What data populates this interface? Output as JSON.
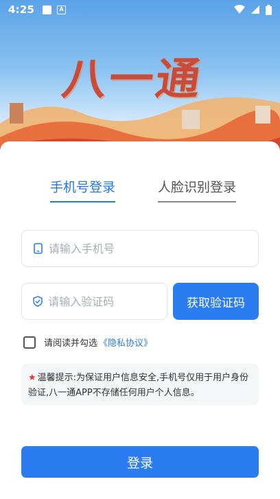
{
  "status_bar": {
    "time": "4:25",
    "icons": [
      "square-icon",
      "a-icon",
      "wifi-icon",
      "signal-icon",
      "battery-icon"
    ]
  },
  "banner": {
    "calligraphy": "八一通"
  },
  "tabs": {
    "phone_login": "手机号登录",
    "face_login": "人脸识别登录",
    "active": "phone_login"
  },
  "form": {
    "phone_placeholder": "请输入手机号",
    "code_placeholder": "请输入验证码",
    "get_code_label": "获取验证码"
  },
  "agreement": {
    "text": "请阅读并勾选",
    "link": "《隐私协议》",
    "checked": false
  },
  "notice": {
    "star": "★",
    "text": "温馨提示:为保证用户信息安全,手机号仅用于用户身份验证,八一通APP不存储任何用户个人信息。"
  },
  "login_button": "登录",
  "colors": {
    "accent": "#2a7cf0",
    "star": "#e53935",
    "calligraphy": "#c94c3a"
  }
}
